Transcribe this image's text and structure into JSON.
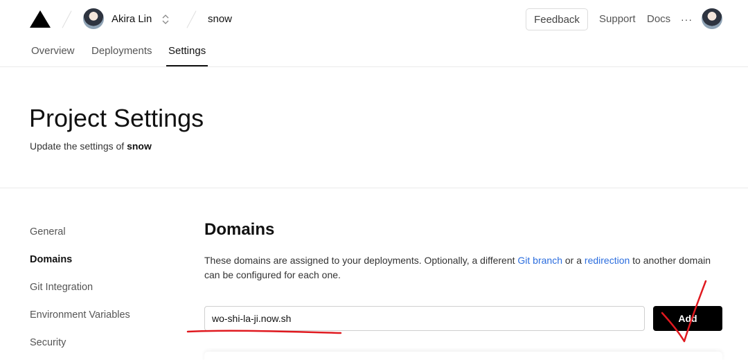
{
  "header": {
    "team_name": "Akira Lin",
    "project_name": "snow",
    "feedback_label": "Feedback",
    "support_label": "Support",
    "docs_label": "Docs",
    "more_label": "···"
  },
  "tabs": [
    {
      "label": "Overview"
    },
    {
      "label": "Deployments"
    },
    {
      "label": "Settings"
    }
  ],
  "page": {
    "title": "Project Settings",
    "subtitle_prefix": "Update the settings of ",
    "subtitle_project": "snow"
  },
  "sidebar": {
    "items": [
      {
        "label": "General"
      },
      {
        "label": "Domains"
      },
      {
        "label": "Git Integration"
      },
      {
        "label": "Environment Variables"
      },
      {
        "label": "Security"
      }
    ]
  },
  "domains": {
    "title": "Domains",
    "desc_part1": "These domains are assigned to your deployments. Optionally, a different ",
    "link_git_branch": "Git branch",
    "desc_part2": " or a ",
    "link_redirection": "redirection",
    "desc_part3": " to another domain can be configured for each one.",
    "input_value": "wo-shi-la-ji.now.sh",
    "add_label": "Add"
  },
  "colors": {
    "link": "#2b6dde",
    "annotation": "#e0191f",
    "button_bg": "#000000"
  }
}
